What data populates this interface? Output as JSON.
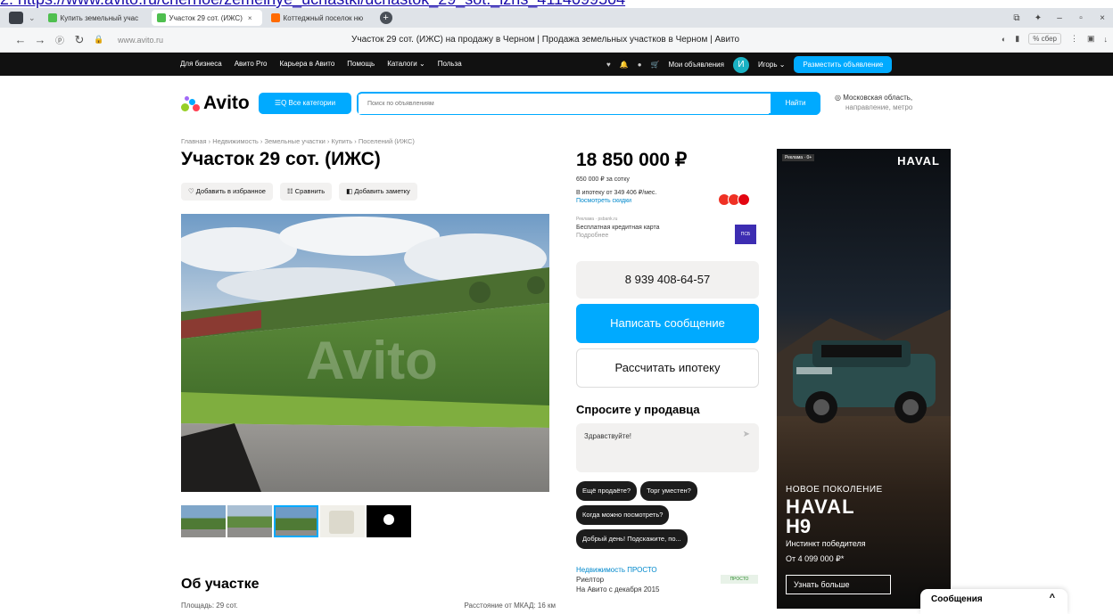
{
  "url_text": "2. https://www.avito.ru/chernoe/zemelnye_uchastki/uchastok_29_sot._izhs_4114099504",
  "browser": {
    "tabs": [
      {
        "label": "Купить земельный учас"
      },
      {
        "label": "Участок 29 сот. (ИЖС)"
      },
      {
        "label": "Коттеджный поселок ню"
      }
    ],
    "host": "www.avito.ru",
    "page_title": "Участок 29 сот. (ИЖС) на продажу в Черном | Продажа земельных участков в Черном | Авито",
    "sber_label": "% сбер"
  },
  "topbar": {
    "left": [
      "Для бизнеса",
      "Авито Pro",
      "Карьера в Авито",
      "Помощь",
      "Каталоги ⌄",
      "Польза"
    ],
    "my_ads": "Мои объявления",
    "user_initial": "И",
    "user_name": "Игорь ⌄",
    "post_button": "Разместить объявление"
  },
  "header": {
    "logo": "Avito",
    "categories_button": "☰Q Все категории",
    "search_placeholder": "Поиск по объявлениям",
    "find_button": "Найти",
    "region_line1": "Московская область,",
    "region_line2": "направление, метро"
  },
  "listing": {
    "breadcrumbs": "Главная › Недвижимость › Земельные участки › Купить › Поселений (ИЖС)",
    "title": "Участок 29 сот. (ИЖС)",
    "actions": {
      "favorite": "♡ Добавить в избранное",
      "compare": "☷ Сравнить",
      "note": "◧ Добавить заметку"
    },
    "watermark": "Avito",
    "about_heading": "Об участке",
    "param_area": "Площадь: 29 сот.",
    "param_distance": "Расстояние от МКАД: 16 км"
  },
  "price": {
    "value": "18 850 000 ₽",
    "per_unit": "650 000 ₽ за сотку",
    "mortgage_line": "В ипотеку от 349 406 ₽/мес.",
    "mortgage_link": "Посмотреть скидки",
    "ad_label": "Реклама · psbank.ru",
    "card_line": "Бесплатная кредитная карта",
    "card_link": "Подробнее",
    "psb_logo": "ПСБ"
  },
  "contact": {
    "phone": "8 939 408-64-57",
    "write_button": "Написать сообщение",
    "mortgage_button": "Рассчитать ипотеку",
    "ask_heading": "Спросите у продавца",
    "ask_text": "Здравствуйте!",
    "chips": [
      "Ещё продаёте?",
      "Торг уместен?",
      "Когда можно посмотреть?",
      "Добрый день! Подскажите, по..."
    ]
  },
  "seller": {
    "company": "Недвижимость ПРОСТО",
    "role": "Риелтор",
    "since": "На Авито с декабря 2015",
    "logo_text": "ПРОСТО"
  },
  "ad": {
    "tag": "Реклама · 0+",
    "brand": "HAVAL",
    "line1": "НОВОЕ ПОКОЛЕНИЕ",
    "line2": "HAVAL",
    "line3": "H9",
    "line4": "Инстинкт победителя",
    "line5": "От 4 099 000 ₽*",
    "button": "Узнать больше"
  },
  "messages": {
    "label": "Сообщения",
    "chevron": "^"
  }
}
